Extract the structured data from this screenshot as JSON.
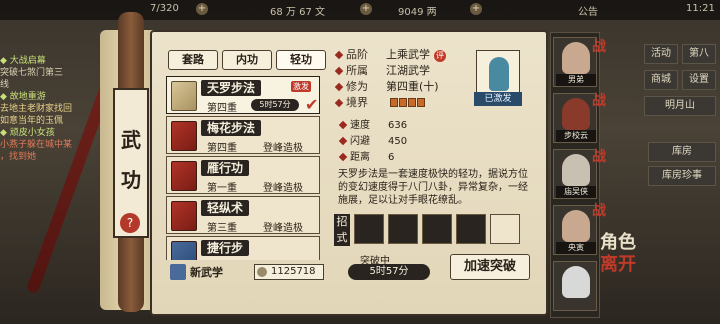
{
  "topbar": {
    "resource1": "7/320",
    "resource2": "68 万 67 文",
    "resource3": "9049 两",
    "notice": "公告",
    "time": "11:21"
  },
  "quest": [
    {
      "text": "◆ 大战启幕",
      "tone": "t"
    },
    {
      "text": "突破七煞门第三",
      "tone": "n"
    },
    {
      "text": "线",
      "tone": "n"
    },
    {
      "text": "◆ 故地重游",
      "tone": "t"
    },
    {
      "text": "去地主老财家找回",
      "tone": "n"
    },
    {
      "text": "如意当年的玉佩",
      "tone": "n"
    },
    {
      "text": "◆ 顽皮小女孩",
      "tone": "t"
    },
    {
      "text": "小燕子躲在城中某",
      "tone": "n"
    },
    {
      "text": "，找到她",
      "tone": "n"
    }
  ],
  "right_menu": {
    "b1": "活动",
    "b2": "第八",
    "b3": "商城",
    "b4": "设置",
    "b5": "明月山",
    "b6": "库房",
    "b7": "库房珍事"
  },
  "sidebar": {
    "title1": "武",
    "title2": "功",
    "help": "?"
  },
  "tabs": [
    "套路",
    "内功",
    "轻功"
  ],
  "list": [
    {
      "name": "天罗步法",
      "level": "第四重",
      "rank": "5时57分",
      "badge": "激发"
    },
    {
      "name": "梅花步法",
      "level": "第四重",
      "rank": "登峰造极"
    },
    {
      "name": "雁行功",
      "level": "第一重",
      "rank": "登峰造极"
    },
    {
      "name": "轻纵术",
      "level": "第三重",
      "rank": "登峰造极"
    },
    {
      "name": "捷行步",
      "level": "",
      "rank": ""
    }
  ],
  "footer": {
    "new_label": "新武学",
    "coins": "1125718"
  },
  "detail": {
    "rank_k": "品阶",
    "rank_v": "上乘武学",
    "rank_badge": "评",
    "cat_k": "所属",
    "cat_v": "江湖武学",
    "cult_k": "修为",
    "cult_v": "第四重(十)",
    "realm_k": "境界",
    "realm_level": 4,
    "portrait_label": "已激发"
  },
  "stats": [
    {
      "k": "速度",
      "v": "636"
    },
    {
      "k": "闪避",
      "v": "450"
    },
    {
      "k": "距离",
      "v": "6"
    }
  ],
  "description": "天罗步法是一套速度极快的轻功，据说方位的变幻速度得于八门八卦，异常复杂，一经施展，足以让对手眼花缭乱。",
  "skills_label": "招式",
  "breakthrough": {
    "label": "突破中",
    "time": "5时57分",
    "button": "加速突破"
  },
  "characters": [
    {
      "name": "男弟"
    },
    {
      "name": "步校云"
    },
    {
      "name": "庙吴侠"
    },
    {
      "name": "央寅"
    },
    {
      "name": ""
    }
  ],
  "fight_label": "战",
  "calli": "角色",
  "calli2": "离开"
}
